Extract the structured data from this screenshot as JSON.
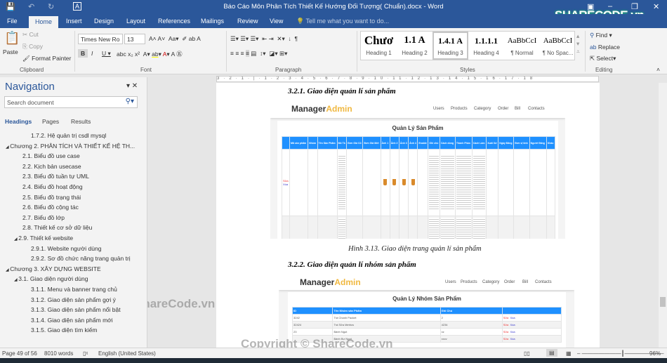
{
  "window": {
    "title": "Báo Cáo Môn Phân Tích Thiết Kế Hướng Đối Tượng( Chuẩn).docx - Word",
    "logo": "SHARECODE.vn"
  },
  "tabs": [
    "File",
    "Home",
    "Insert",
    "Design",
    "Layout",
    "References",
    "Mailings",
    "Review",
    "View"
  ],
  "tell_me": "Tell me what you want to do...",
  "clipboard": {
    "paste": "Paste",
    "cut": "Cut",
    "copy": "Copy",
    "format_painter": "Format Painter",
    "label": "Clipboard"
  },
  "font": {
    "name": "Times New Ro",
    "size": "13",
    "label": "Font"
  },
  "paragraph": {
    "label": "Paragraph"
  },
  "styles": {
    "label": "Styles",
    "items": [
      {
        "sample": "Chươ",
        "name": "Heading 1"
      },
      {
        "sample": "1.1  A",
        "name": "Heading 2"
      },
      {
        "sample": "1.4.1  A",
        "name": "Heading 3"
      },
      {
        "sample": "1.1.1.1",
        "name": "Heading 4"
      },
      {
        "sample": "AaBbCcI",
        "name": "¶ Normal"
      },
      {
        "sample": "AaBbCcI",
        "name": "¶ No Spac..."
      }
    ],
    "selected": "Heading 3"
  },
  "editing": {
    "find": "Find",
    "replace": "Replace",
    "select": "Select",
    "label": "Editing"
  },
  "nav": {
    "title": "Navigation",
    "search_placeholder": "Search document",
    "tabs": [
      "Headings",
      "Pages",
      "Results"
    ],
    "items": [
      "1.7.2. Hệ quản trị csdl mysql",
      "Chương 2. PHÂN TÍCH VÀ THIẾT KẾ HỆ TH...",
      "2.1. Biểu đồ use case",
      "2.2. Kịch bản usecase",
      "2.3. Biểu đồ tuần tự UML",
      "2.4. Biểu đồ hoạt động",
      "2.5. Biểu đồ trạng thái",
      "2.6. Biểu đồ cộng tác",
      "2.7. Biểu đồ lớp",
      "2.8. Thiết kế cơ sở dữ liệu",
      "2.9. Thiết kế website",
      "2.9.1. Website người dùng",
      "2.9.2. Sơ đồ chức năng trang quản trị",
      "Chương 3. XÂY DỰNG WEBSITE",
      "3.1. Giao diện người dùng",
      "3.1.1. Menu và banner trang chủ",
      "3.1.2. Giao diện sản phẩm gợi ý",
      "3.1.3. Giao diện sản phẩm nổi bật",
      "3.1.4. Giao diện sản phẩm mới",
      "3.1.5. Giao diện tìm kiếm"
    ]
  },
  "doc": {
    "heading1": "3.2.1. Giao diện quản lí sản phẩm",
    "caption1": "Hình 3.13. Giao diện trang quản lí sản phẩm",
    "heading2": "3.2.2. Giao diện quản lí nhóm sản phẩm",
    "admin": {
      "brand1": "Manager",
      "brand2": "Admin",
      "menu": [
        "Users",
        "Products",
        "Category",
        "Order",
        "Bill",
        "Contacts"
      ]
    },
    "products": {
      "title": "Quản Lý Sản Phẩm",
      "columns": [
        "",
        "Mã sản phẩm",
        "Nhóm",
        "Tên Sản Phẩm",
        "Mô Tả",
        "Đơn Giá Cũ",
        "Đơn Giá Mới",
        "Ảnh 1",
        "Ảnh 2",
        "Ảnh 3",
        "Ảnh 4",
        "Enable",
        "Ghi chú",
        "Cách dùng",
        "Thành Phần",
        "Cách Làm",
        "Xuất Xứ",
        "Ngày Đăng",
        "Đơn vị tính",
        "Người Đăng",
        "Khác"
      ],
      "edit": "Sửa",
      "delete": "Xóa"
    },
    "categories": {
      "title": "Quản Lý Nhóm Sản Phẩm",
      "columns": [
        "ID",
        "Tên Nhóm sản Phẩm",
        "Ghi Chú",
        ""
      ],
      "rows": [
        [
          "3242",
          "Trà Chanh Packet",
          "2"
        ],
        [
          "32424",
          "Trà Sữa Metrics",
          "4234"
        ],
        [
          "23",
          "Bánh Ngọt",
          "xz"
        ],
        [
          "",
          "Bánh Bự Ngọt",
          "xxcv"
        ]
      ],
      "edit": "Sửa",
      "delete": "Xóa"
    }
  },
  "status": {
    "page": "Page 49 of 56",
    "words": "8010 words",
    "language": "English (United States)",
    "zoom": "96%"
  },
  "watermarks": [
    "ShareCode.vn",
    "Copyright © ShareCode.vn"
  ]
}
